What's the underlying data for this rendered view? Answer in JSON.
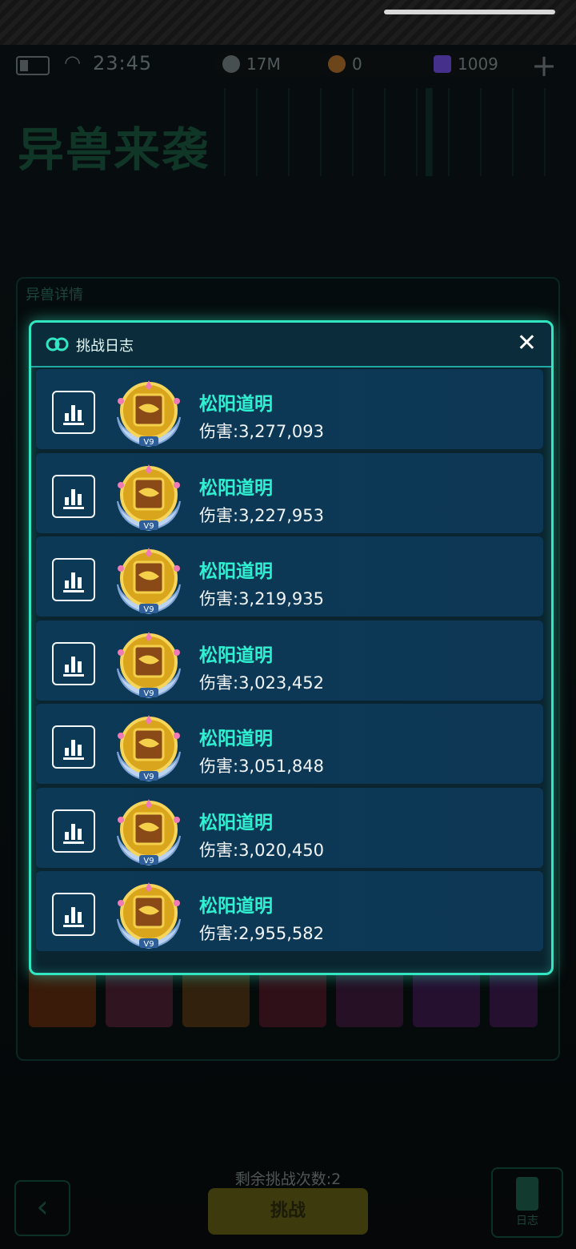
{
  "status_bar": {
    "time": "23:45"
  },
  "resources": [
    {
      "name": "coin",
      "value": "17M",
      "color": "#6f7a7c"
    },
    {
      "name": "medal",
      "value": "0",
      "color": "#a86a2a"
    },
    {
      "name": "cube",
      "value": "1009",
      "color": "#6b4bd8"
    }
  ],
  "page": {
    "title": "异兽来袭",
    "details_tab": "异兽详情"
  },
  "modal": {
    "title": "挑战日志",
    "rows": [
      {
        "name": "松阳道明",
        "damage": "伤害:3,277,093",
        "badge": "V9"
      },
      {
        "name": "松阳道明",
        "damage": "伤害:3,227,953",
        "badge": "V9"
      },
      {
        "name": "松阳道明",
        "damage": "伤害:3,219,935",
        "badge": "V9"
      },
      {
        "name": "松阳道明",
        "damage": "伤害:3,023,452",
        "badge": "V9"
      },
      {
        "name": "松阳道明",
        "damage": "伤害:3,051,848",
        "badge": "V9"
      },
      {
        "name": "松阳道明",
        "damage": "伤害:3,020,450",
        "badge": "V9"
      },
      {
        "name": "松阳道明",
        "damage": "伤害:2,955,582",
        "badge": "V9"
      }
    ]
  },
  "footer": {
    "remaining": "剩余挑战次数:2",
    "challenge_label": "挑战",
    "log_label": "日志"
  },
  "colors": {
    "accent": "#33e6c2",
    "name_text": "#2ff0d0",
    "row_bg": "#0c3956"
  }
}
